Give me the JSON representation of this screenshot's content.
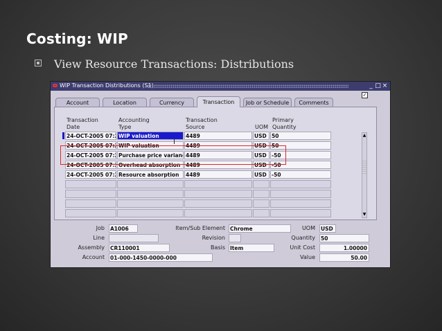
{
  "slide": {
    "title": "Costing: WIP",
    "bullet": "View Resource Transactions: Distributions"
  },
  "window": {
    "title": "WIP Transaction Distributions (S1)",
    "controls": [
      "_",
      "□",
      "×"
    ],
    "tabs": [
      "Account",
      "Location",
      "Currency",
      "Transaction",
      "Job or Schedule",
      "Comments"
    ],
    "active_tab": "Transaction"
  },
  "grid": {
    "headers": {
      "date_line1": "Transaction",
      "date_line2": "Date",
      "type_line1": "Accounting",
      "type_line2": "Type",
      "source_line1": "Transaction",
      "source_line2": "Source",
      "uom": "UOM",
      "qty_line1": "Primary",
      "qty_line2": "Quantity"
    },
    "rows": [
      {
        "date": "24-OCT-2005 07:2",
        "type": "WIP valuation",
        "source": "4489",
        "uom": "USD",
        "qty": "50"
      },
      {
        "date": "24-OCT-2005 07:2",
        "type": "WIP valuation",
        "source": "4489",
        "uom": "USD",
        "qty": "50"
      },
      {
        "date": "24-OCT-2005 07:2",
        "type": "Purchase price varianc",
        "source": "4489",
        "uom": "USD",
        "qty": "-50"
      },
      {
        "date": "24-OCT-2005 07:2",
        "type": "Overhead absorption",
        "source": "4489",
        "uom": "USD",
        "qty": "-50"
      },
      {
        "date": "24-OCT-2005 07:2",
        "type": "Resource absorption",
        "source": "4489",
        "uom": "USD",
        "qty": "-50"
      }
    ],
    "empty_rows": 4
  },
  "details": {
    "job_label": "Job",
    "job": "A1006",
    "line_label": "Line",
    "line": "",
    "assembly_label": "Assembly",
    "assembly": "CR110001",
    "account_label": "Account",
    "account": "01-000-1450-0000-000",
    "item_label": "Item/Sub Element",
    "item": "Chrome",
    "revision_label": "Revision",
    "revision": "",
    "basis_label": "Basis",
    "basis": "Item",
    "uom_label": "UOM",
    "uom": "USD",
    "quantity_label": "Quantity",
    "quantity": "50",
    "unit_cost_label": "Unit Cost",
    "unit_cost": "1.00000",
    "value_label": "Value",
    "value": "50.00"
  }
}
